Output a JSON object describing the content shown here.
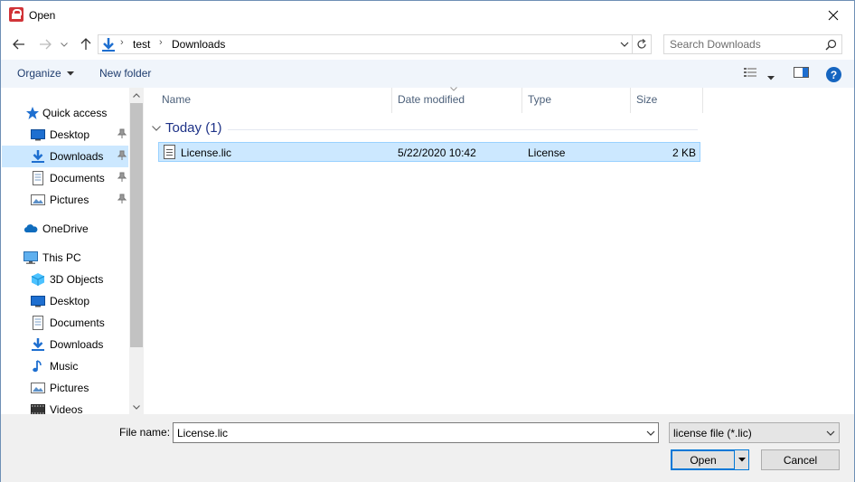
{
  "window": {
    "title": "Open"
  },
  "address": {
    "segments": [
      "test",
      "Downloads"
    ],
    "search_placeholder": "Search Downloads"
  },
  "toolbar": {
    "organize_label": "Organize",
    "new_folder_label": "New folder"
  },
  "nav": {
    "items": [
      {
        "label": "Quick access",
        "icon": "star-icon"
      },
      {
        "label": "Desktop",
        "icon": "desktop-icon",
        "pinned": true
      },
      {
        "label": "Downloads",
        "icon": "download-icon",
        "pinned": true,
        "selected": true
      },
      {
        "label": "Documents",
        "icon": "documents-icon",
        "pinned": true
      },
      {
        "label": "Pictures",
        "icon": "pictures-icon",
        "pinned": true
      },
      {
        "label": "OneDrive",
        "icon": "cloud-icon"
      },
      {
        "label": "This PC",
        "icon": "computer-icon"
      },
      {
        "label": "3D Objects",
        "icon": "cube-icon"
      },
      {
        "label": "Desktop",
        "icon": "desktop-icon"
      },
      {
        "label": "Documents",
        "icon": "documents-icon"
      },
      {
        "label": "Downloads",
        "icon": "download-icon"
      },
      {
        "label": "Music",
        "icon": "music-icon"
      },
      {
        "label": "Pictures",
        "icon": "pictures-icon"
      },
      {
        "label": "Videos",
        "icon": "videos-icon"
      }
    ]
  },
  "filelist": {
    "columns": [
      "Name",
      "Date modified",
      "Type",
      "Size"
    ],
    "group": {
      "label": "Today (1)"
    },
    "rows": [
      {
        "name": "License.lic",
        "date": "5/22/2020 10:42",
        "type": "License",
        "size": "2 KB",
        "selected": true
      }
    ]
  },
  "bottom": {
    "filename_label": "File name:",
    "filename_value": "License.lic",
    "filter_value": "license file (*.lic)",
    "open_label": "Open",
    "cancel_label": "Cancel"
  },
  "colors": {
    "accent": "#0078d7",
    "selection": "#cce8ff",
    "group_header": "#1e3287",
    "toolbar_bg": "#f0f5fb"
  }
}
